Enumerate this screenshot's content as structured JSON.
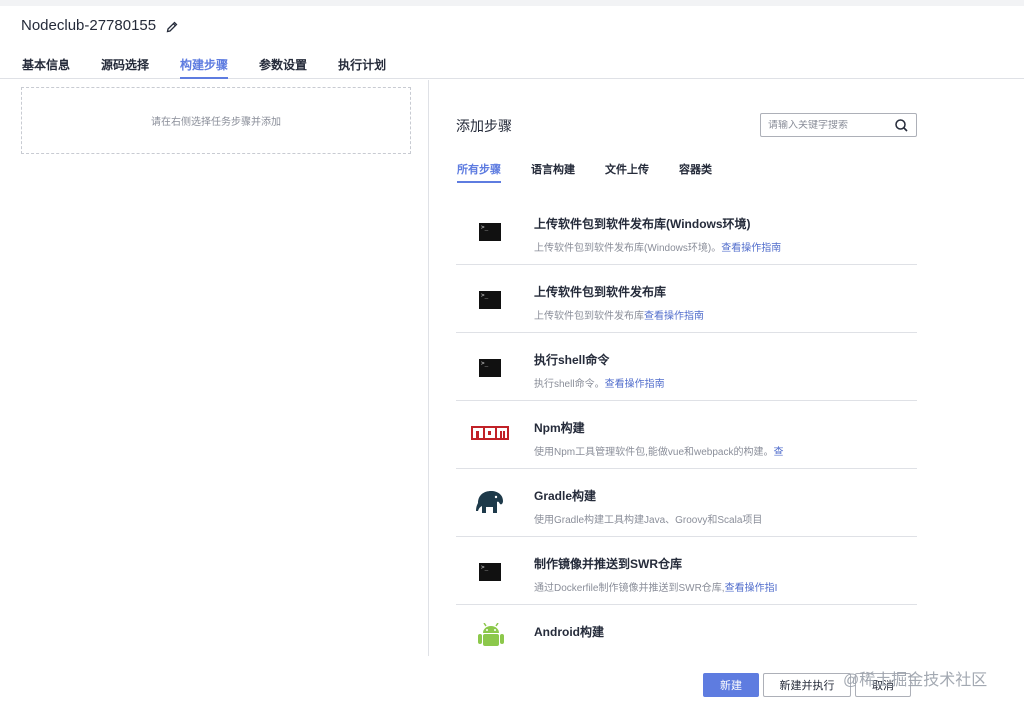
{
  "header": {
    "title": "Nodeclub-27780155",
    "tabs": [
      {
        "label": "基本信息",
        "active": false
      },
      {
        "label": "源码选择",
        "active": false
      },
      {
        "label": "构建步骤",
        "active": true
      },
      {
        "label": "参数设置",
        "active": false
      },
      {
        "label": "执行计划",
        "active": false
      }
    ]
  },
  "left": {
    "placeholder": "请在右侧选择任务步骤并添加"
  },
  "right": {
    "title": "添加步骤",
    "search_placeholder": "请输入关键字搜索",
    "categories": [
      {
        "label": "所有步骤",
        "active": true
      },
      {
        "label": "语言构建",
        "active": false
      },
      {
        "label": "文件上传",
        "active": false
      },
      {
        "label": "容器类",
        "active": false
      }
    ],
    "steps": [
      {
        "icon": "terminal-icon",
        "name": "上传软件包到软件发布库(Windows环境)",
        "desc": "上传软件包到软件发布库(Windows环境)。",
        "link": "查看操作指南"
      },
      {
        "icon": "terminal-icon",
        "name": "上传软件包到软件发布库",
        "desc": "上传软件包到软件发布库",
        "link": "查看操作指南"
      },
      {
        "icon": "terminal-icon",
        "name": "执行shell命令",
        "desc": "执行shell命令。",
        "link": "查看操作指南"
      },
      {
        "icon": "npm-logo-icon",
        "name": "Npm构建",
        "desc": "使用Npm工具管理软件包,能做vue和webpack的构建。",
        "link": "查"
      },
      {
        "icon": "gradle-elephant-icon",
        "name": "Gradle构建",
        "desc": "使用Gradle构建工具构建Java、Groovy和Scala项目",
        "link": ""
      },
      {
        "icon": "terminal-icon",
        "name": "制作镜像并推送到SWR仓库",
        "desc": "通过Dockerfile制作镜像并推送到SWR仓库,",
        "link": "查看操作指I"
      },
      {
        "icon": "android-icon",
        "name": "Android构建",
        "desc": "",
        "link": ""
      }
    ]
  },
  "footer": {
    "create_label": "新建",
    "create_run_label": "新建并执行",
    "cancel_label": "取消",
    "watermark": "@稀土掘金技术社区"
  },
  "colors": {
    "accent": "#5e7ce0",
    "link": "#526ecc",
    "npm_red": "#c12127",
    "gradle_dark": "#1e3a4a",
    "android_green": "#8cc84b"
  }
}
